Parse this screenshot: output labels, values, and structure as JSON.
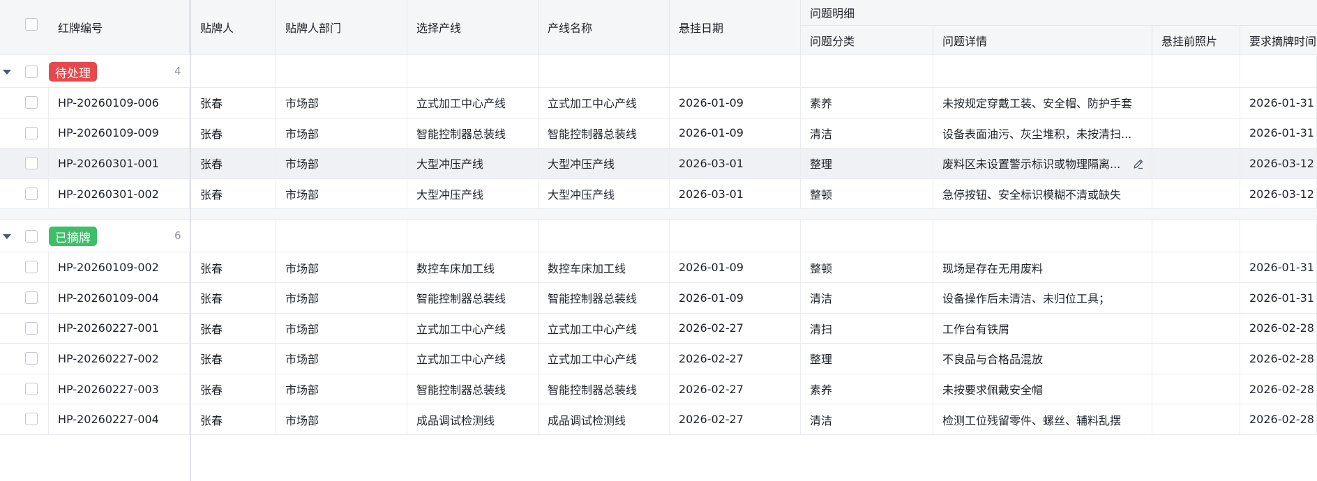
{
  "header": {
    "id": "红牌编号",
    "poster": "贴牌人",
    "dept": "贴牌人部门",
    "line_select": "选择产线",
    "line_name": "产线名称",
    "date": "悬挂日期",
    "issue_group": "问题明细",
    "category": "问题分类",
    "detail": "问题详情",
    "photo": "悬挂前照片",
    "required": "要求摘牌时间"
  },
  "groups": [
    {
      "label": "待处理",
      "color": "#e5484d",
      "count": "4",
      "rows": [
        {
          "id": "HP-20260109-006",
          "poster": "张春",
          "dept": "市场部",
          "line_select": "立式加工中心产线",
          "line_name": "立式加工中心产线",
          "date": "2026-01-09",
          "category": "素养",
          "detail": "未按规定穿戴工装、安全帽、防护手套",
          "required": "2026-01-31"
        },
        {
          "id": "HP-20260109-009",
          "poster": "张春",
          "dept": "市场部",
          "line_select": "智能控制器总装线",
          "line_name": "智能控制器总装线",
          "date": "2026-01-09",
          "category": "清洁",
          "detail": "设备表面油污、灰尘堆积，未按清扫...",
          "required": "2026-01-31"
        },
        {
          "id": "HP-20260301-001",
          "poster": "张春",
          "dept": "市场部",
          "line_select": "大型冲压产线",
          "line_name": "大型冲压产线",
          "date": "2026-03-01",
          "category": "整理",
          "detail": "废料区未设置警示标识或物理隔离...",
          "required": "2026-03-12"
        },
        {
          "id": "HP-20260301-002",
          "poster": "张春",
          "dept": "市场部",
          "line_select": "大型冲压产线",
          "line_name": "大型冲压产线",
          "date": "2026-03-01",
          "category": "整顿",
          "detail": "急停按钮、安全标识模糊不清或缺失",
          "required": "2026-03-12"
        }
      ]
    },
    {
      "label": "已摘牌",
      "color": "#3dbe67",
      "count": "6",
      "rows": [
        {
          "id": "HP-20260109-002",
          "poster": "张春",
          "dept": "市场部",
          "line_select": "数控车床加工线",
          "line_name": "数控车床加工线",
          "date": "2026-01-09",
          "category": "整顿",
          "detail": "现场是存在无用废料",
          "required": "2026-01-31"
        },
        {
          "id": "HP-20260109-004",
          "poster": "张春",
          "dept": "市场部",
          "line_select": "智能控制器总装线",
          "line_name": "智能控制器总装线",
          "date": "2026-01-09",
          "category": "清洁",
          "detail": "设备操作后未清洁、未归位工具；",
          "required": "2026-01-31"
        },
        {
          "id": "HP-20260227-001",
          "poster": "张春",
          "dept": "市场部",
          "line_select": "立式加工中心产线",
          "line_name": "立式加工中心产线",
          "date": "2026-02-27",
          "category": "清扫",
          "detail": "工作台有铁屑",
          "required": "2026-02-28"
        },
        {
          "id": "HP-20260227-002",
          "poster": "张春",
          "dept": "市场部",
          "line_select": "立式加工中心产线",
          "line_name": "立式加工中心产线",
          "date": "2026-02-27",
          "category": "整理",
          "detail": "不良品与合格品混放",
          "required": "2026-02-28"
        },
        {
          "id": "HP-20260227-003",
          "poster": "张春",
          "dept": "市场部",
          "line_select": "智能控制器总装线",
          "line_name": "智能控制器总装线",
          "date": "2026-02-27",
          "category": "素养",
          "detail": "未按要求佩戴安全帽",
          "required": "2026-02-28"
        },
        {
          "id": "HP-20260227-004",
          "poster": "张春",
          "dept": "市场部",
          "line_select": "成品调试检测线",
          "line_name": "成品调试检测线",
          "date": "2026-02-27",
          "category": "清洁",
          "detail": "检测工位残留零件、螺丝、辅料乱摆",
          "required": "2026-02-28"
        }
      ]
    }
  ]
}
